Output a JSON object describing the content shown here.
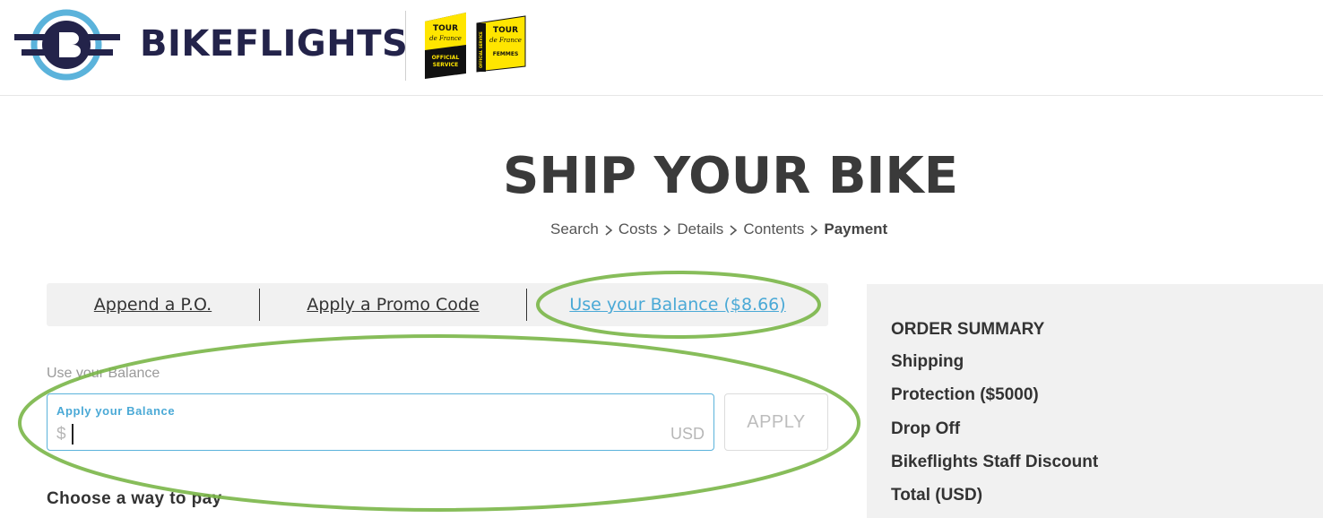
{
  "header": {
    "brand_name": "BIKEFLIGHTS",
    "logo_icon": "bikeflights-wheel-logo",
    "badges": [
      "tour-de-france-official-service-badge",
      "tour-de-france-femmes-badge"
    ],
    "badge1_text": [
      "TOUR",
      "de France",
      "OFFICIAL",
      "SERVICE"
    ],
    "badge2_text": [
      "TOUR",
      "de France",
      "FEMMES",
      "OFFICIAL SERVICE"
    ]
  },
  "page": {
    "title": "SHIP YOUR BIKE"
  },
  "breadcrumb": {
    "items": [
      "Search",
      "Costs",
      "Details",
      "Contents",
      "Payment"
    ],
    "active_index": 4,
    "separator_icon": "chevron-right-icon"
  },
  "tabs": [
    {
      "label": "Append a P.O."
    },
    {
      "label": "Apply a Promo Code"
    },
    {
      "label": "Use your Balance ($8.66)"
    }
  ],
  "balance": {
    "section_label": "Use your Balance",
    "field_label": "Apply your Balance",
    "prefix": "$",
    "suffix": "USD",
    "value": "",
    "apply_label": "APPLY"
  },
  "payment": {
    "heading": "Choose a way to pay"
  },
  "order_summary": {
    "title": "ORDER SUMMARY",
    "lines": [
      "Shipping",
      "Protection ($5000)",
      "Drop Off",
      "Bikeflights Staff Discount",
      "Total (USD)"
    ]
  },
  "colors": {
    "accent": "#4aa9d6",
    "brand_navy": "#23234a",
    "annotation_green": "#7ab648",
    "panel_bg": "#f1f1f1"
  }
}
